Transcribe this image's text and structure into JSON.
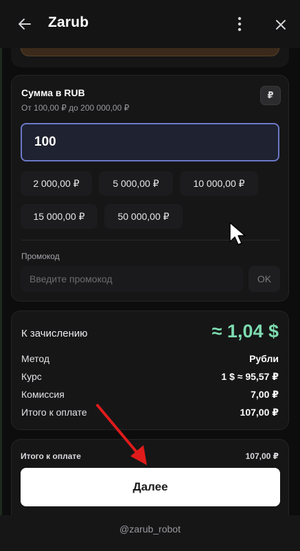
{
  "header": {
    "title": "Zarub",
    "back_icon": "arrow-left-icon",
    "more_icon": "dots-vertical-icon",
    "close_icon": "close-icon"
  },
  "amount": {
    "title": "Сумма в RUB",
    "range": "От 100,00 ₽ до 200 000,00 ₽",
    "currency_badge": "₽",
    "input_value": "100",
    "presets": [
      "2 000,00 ₽",
      "5 000,00 ₽",
      "10 000,00 ₽",
      "15 000,00 ₽",
      "50 000,00 ₽"
    ]
  },
  "promo": {
    "label": "Промокод",
    "placeholder": "Введите промокод",
    "ok_label": "OK"
  },
  "summary": {
    "credit_label": "К зачислению",
    "credit_value": "≈ 1,04 $",
    "rows": [
      {
        "label": "Метод",
        "value": "Рубли"
      },
      {
        "label": "Курс",
        "value": "1 $ ≈ 95,57 ₽"
      },
      {
        "label": "Комиссия",
        "value": "7,00 ₽"
      },
      {
        "label": "Итого к оплате",
        "value": "107,00 ₽"
      }
    ]
  },
  "footer": {
    "total_label": "Итого к оплате",
    "total_value": "107,00 ₽",
    "next_label": "Далее"
  },
  "bot_handle": "@zarub_robot",
  "colors": {
    "accent_green": "#7ddbb0",
    "input_border": "#6b79c9",
    "annotation_arrow": "#e01b1b"
  }
}
